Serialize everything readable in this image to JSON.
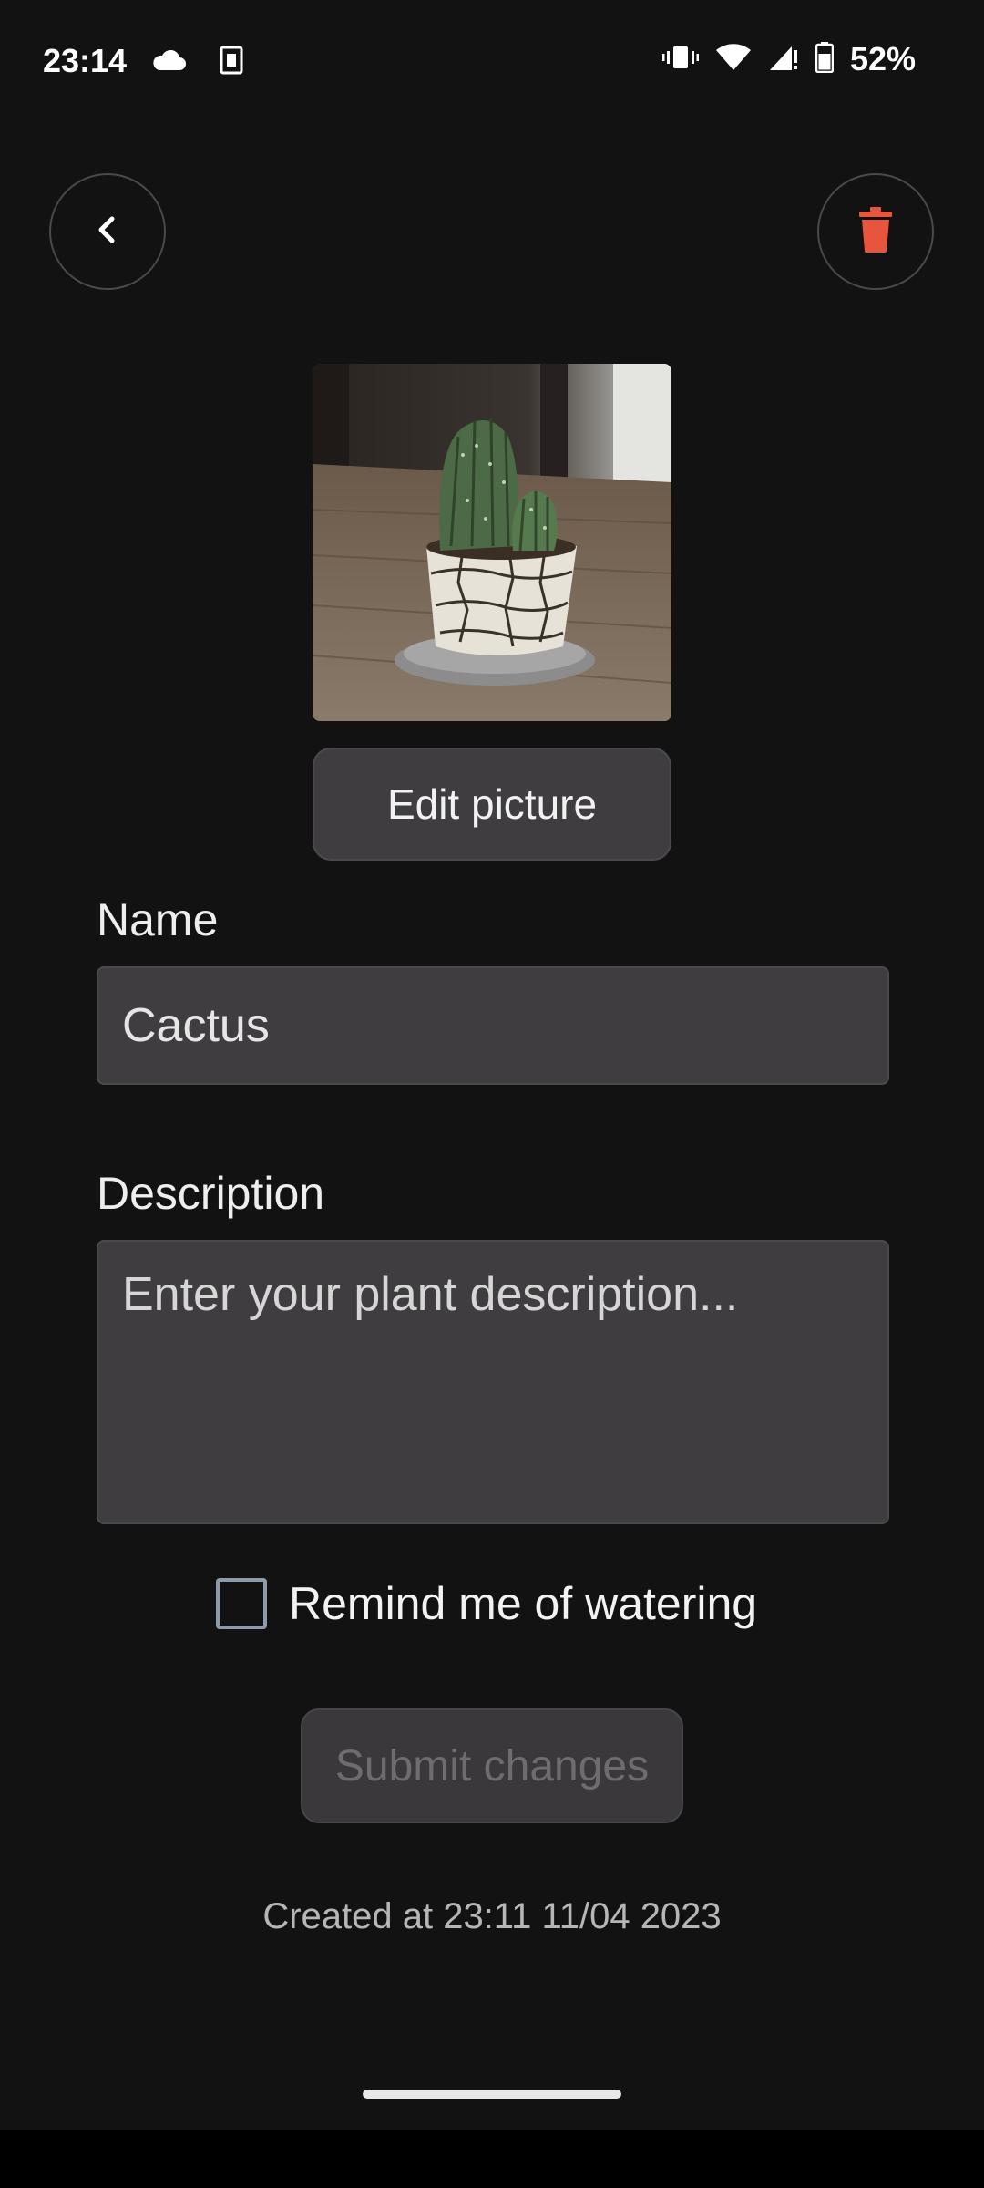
{
  "status_bar": {
    "time": "23:14",
    "battery_text": "52%",
    "left_icons": [
      "cloud-icon",
      "sim-card-icon"
    ],
    "right_icons": [
      "vibrate-icon",
      "wifi-icon",
      "signal-icon",
      "battery-icon"
    ]
  },
  "toolbar": {
    "back_icon": "chevron-left-icon",
    "delete_icon": "trash-icon",
    "delete_color": "#e8553f"
  },
  "photo": {
    "subject": "cactus-photo"
  },
  "edit_picture": {
    "label": "Edit picture"
  },
  "form": {
    "name_label": "Name",
    "name_value": "Cactus",
    "description_label": "Description",
    "description_value": "",
    "description_placeholder": "Enter your plant description...",
    "remind_label": "Remind me of watering",
    "remind_checked": false
  },
  "submit": {
    "label": "Submit changes",
    "enabled": false
  },
  "footer": {
    "created_at": "Created at 23:11 11/04 2023"
  },
  "colors": {
    "background": "#121212",
    "field_bg": "#3f3d40",
    "accent_delete": "#e8553f"
  }
}
